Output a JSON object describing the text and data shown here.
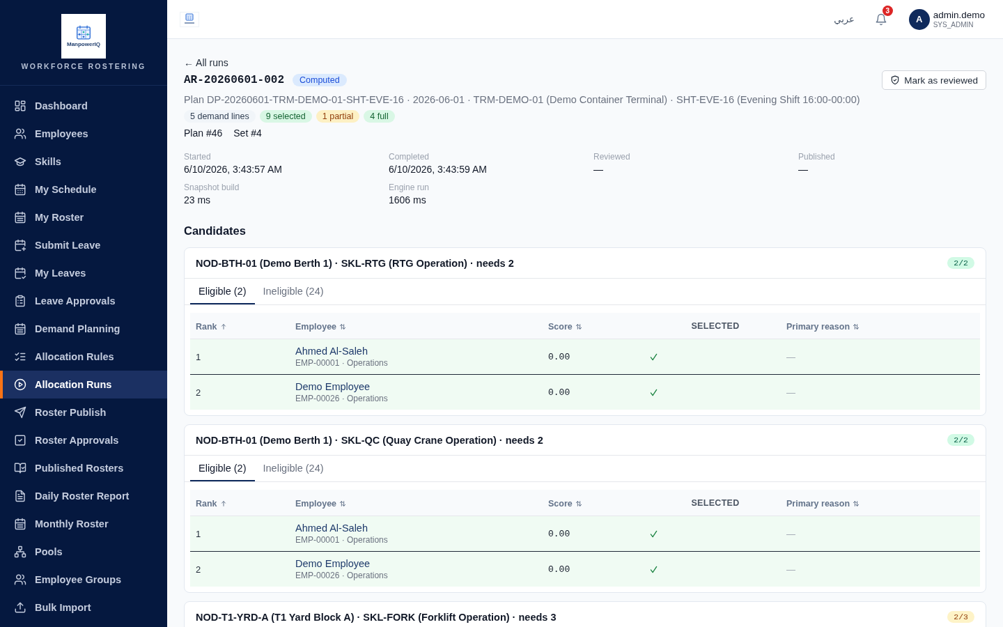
{
  "sidebar": {
    "logo_text": "ManpowerIQ",
    "subtitle": "WORKFORCE ROSTERING",
    "items": [
      {
        "label": "Dashboard",
        "selected": false
      },
      {
        "label": "Employees",
        "selected": false
      },
      {
        "label": "Skills",
        "selected": false
      },
      {
        "label": "My Schedule",
        "selected": false
      },
      {
        "label": "My Roster",
        "selected": false
      },
      {
        "label": "Submit Leave",
        "selected": false
      },
      {
        "label": "My Leaves",
        "selected": false
      },
      {
        "label": "Leave Approvals",
        "selected": false
      },
      {
        "label": "Demand Planning",
        "selected": false
      },
      {
        "label": "Allocation Rules",
        "selected": false
      },
      {
        "label": "Allocation Runs",
        "selected": true
      },
      {
        "label": "Roster Publish",
        "selected": false
      },
      {
        "label": "Roster Approvals",
        "selected": false
      },
      {
        "label": "Published Rosters",
        "selected": false
      },
      {
        "label": "Daily Roster Report",
        "selected": false
      },
      {
        "label": "Monthly Roster",
        "selected": false
      },
      {
        "label": "Pools",
        "selected": false
      },
      {
        "label": "Employee Groups",
        "selected": false
      },
      {
        "label": "Bulk Import",
        "selected": false
      }
    ]
  },
  "topbar": {
    "language": "عربي",
    "notifications": "3",
    "user": {
      "initial": "A",
      "name": "admin.demo",
      "role": "SYS_ADMIN"
    }
  },
  "header": {
    "back_link": "← All runs",
    "run_id": "AR-20260601-002",
    "status": "Computed",
    "action": "Mark as reviewed",
    "plan_line": "Plan DP-20260601-TRM-DEMO-01-SHT-EVE-16 · 2026-06-01 · TRM-DEMO-01 (Demo Container Terminal) · SHT-EVE-16 (Evening Shift 16:00-00:00)",
    "chips": [
      {
        "label": "5 demand lines",
        "kind": "neutral"
      },
      {
        "label": "9 selected",
        "kind": "success"
      },
      {
        "label": "1 partial",
        "kind": "warning"
      },
      {
        "label": "4 full",
        "kind": "success"
      }
    ],
    "refs": [
      "Plan #46",
      "Set #4"
    ]
  },
  "stats": [
    {
      "label": "Started",
      "value": "6/10/2026, 3:43:57 AM"
    },
    {
      "label": "Completed",
      "value": "6/10/2026, 3:43:59 AM"
    },
    {
      "label": "Reviewed",
      "value": "—"
    },
    {
      "label": "Published",
      "value": "—"
    },
    {
      "label": "Snapshot build",
      "value": "23 ms"
    },
    {
      "label": "Engine run",
      "value": "1606 ms"
    }
  ],
  "candidates": {
    "title": "Candidates",
    "groups": [
      {
        "title": "NOD-BTH-01 (Demo Berth 1) · SKL-RTG (RTG Operation) · needs 2",
        "fill": "2/2",
        "complete": true,
        "tabs": [
          {
            "label": "Eligible (2)",
            "selected": true
          },
          {
            "label": "Ineligible (24)",
            "selected": false
          }
        ],
        "columns": [
          "Rank",
          "Employee",
          "Score",
          "SELECTED",
          "Primary reason"
        ],
        "rows": [
          {
            "rank": "1",
            "name": "Ahmed Al-Saleh",
            "meta": "EMP-00001 · Operations",
            "score": "0.00",
            "selected": true,
            "reason": "—"
          },
          {
            "rank": "2",
            "name": "Demo Employee",
            "meta": "EMP-00026 · Operations",
            "score": "0.00",
            "selected": true,
            "reason": "—"
          }
        ]
      },
      {
        "title": "NOD-BTH-01 (Demo Berth 1) · SKL-QC (Quay Crane Operation) · needs 2",
        "fill": "2/2",
        "complete": true,
        "tabs": [
          {
            "label": "Eligible (2)",
            "selected": true
          },
          {
            "label": "Ineligible (24)",
            "selected": false
          }
        ],
        "columns": [
          "Rank",
          "Employee",
          "Score",
          "SELECTED",
          "Primary reason"
        ],
        "rows": [
          {
            "rank": "1",
            "name": "Ahmed Al-Saleh",
            "meta": "EMP-00001 · Operations",
            "score": "0.00",
            "selected": true,
            "reason": "—"
          },
          {
            "rank": "2",
            "name": "Demo Employee",
            "meta": "EMP-00026 · Operations",
            "score": "0.00",
            "selected": true,
            "reason": "—"
          }
        ]
      },
      {
        "title": "NOD-T1-YRD-A (T1 Yard Block A) · SKL-FORK (Forklift Operation) · needs 3",
        "fill": "2/3",
        "complete": false
      }
    ]
  }
}
